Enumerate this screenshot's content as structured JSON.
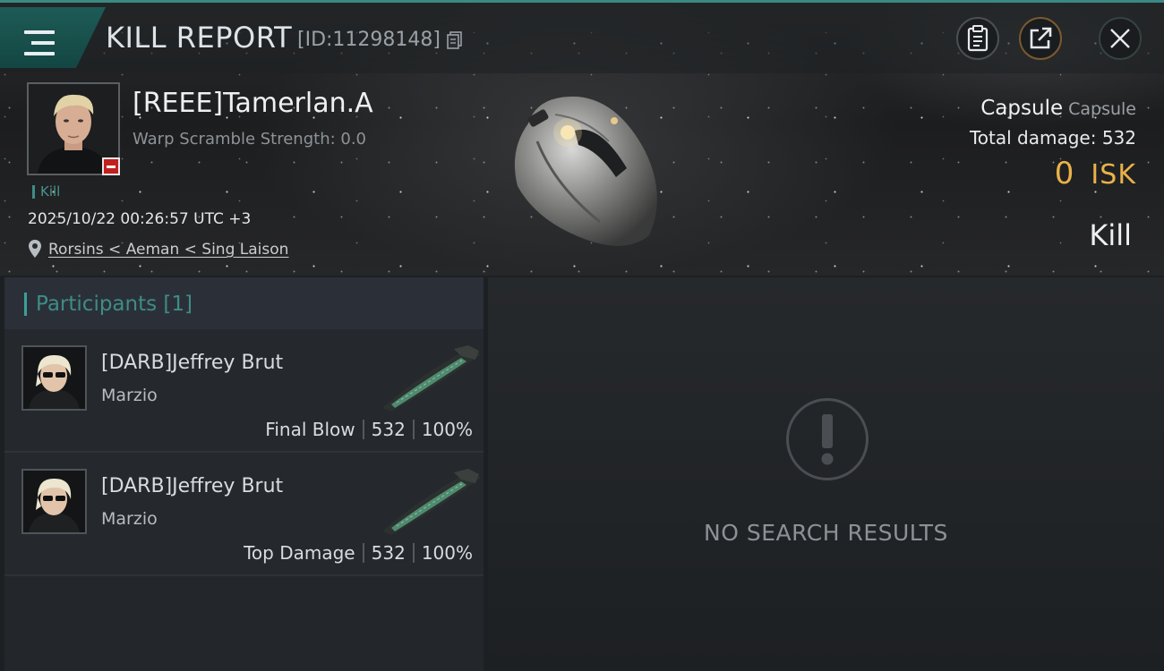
{
  "header": {
    "title": "KILL REPORT",
    "report_id": "[ID:11298148]"
  },
  "victim": {
    "name": "[REEE]Tamerlan.A",
    "warp_scramble": "Warp Scramble Strength: 0.0",
    "kill_tag": "Kill",
    "datetime": "2025/10/22 00:26:57 UTC +3",
    "location": "Rorsins < Aeman < Sing Laison"
  },
  "ship_info": {
    "name": "Capsule",
    "class": "Capsule",
    "total_damage": "Total damage:  532",
    "isk_value": "0",
    "isk_unit": "ISK",
    "result": "Kill"
  },
  "participants": {
    "header": "Participants [1]",
    "rows": [
      {
        "name": "[DARB]Jeffrey Brut",
        "ship": "Marzio",
        "role": "Final Blow",
        "damage": "532",
        "percent": "100%"
      },
      {
        "name": "[DARB]Jeffrey Brut",
        "ship": "Marzio",
        "role": "Top Damage",
        "damage": "532",
        "percent": "100%"
      }
    ]
  },
  "results": {
    "empty_text": "NO SEARCH RESULTS"
  },
  "icons": {
    "menu": "hamburger-menu-icon",
    "copy": "copy-icon",
    "clipboard": "clipboard-icon",
    "share": "share-icon",
    "close": "close-icon",
    "location": "location-pin-icon",
    "empty": "exclamation-icon"
  },
  "colors": {
    "accent": "#3b9f97",
    "isk": "#e9b24a",
    "negative_badge": "#c0201f"
  }
}
